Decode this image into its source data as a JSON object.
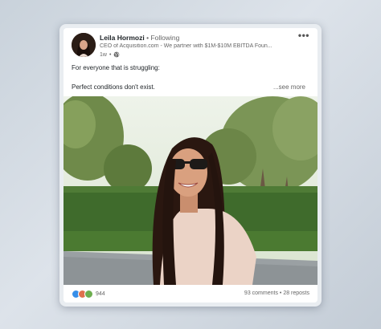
{
  "post": {
    "author": "Leila Hormozi",
    "separator": "•",
    "follow_status": "Following",
    "headline": "CEO of Acquisition.com - We partner with $1M-$10M EBITDA Foun...",
    "time": "1w",
    "visibility_sep": "•",
    "visibility_icon": "globe-icon",
    "more_icon": "•••",
    "line1": "For everyone that is struggling:",
    "line2": "Perfect conditions don't exist.",
    "see_more": "...see more"
  },
  "footer": {
    "reaction_icons": [
      "like-icon",
      "celebrate-icon",
      "support-icon"
    ],
    "reaction_colors": [
      "#378fe9",
      "#df704d",
      "#6dae4f"
    ],
    "reaction_count": "944",
    "comments": "93 comments",
    "stat_sep": "•",
    "reposts": "28 reposts"
  }
}
